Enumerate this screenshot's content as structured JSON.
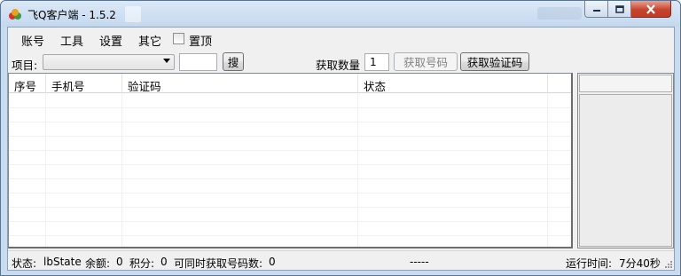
{
  "window": {
    "title": "飞Q客户端 - 1.5.2"
  },
  "menu": {
    "account": "账号",
    "tools": "工具",
    "settings": "设置",
    "other": "其它",
    "pin_top": "置顶",
    "pin_top_checked": false
  },
  "toolbar": {
    "project_label": "项目:",
    "project_value": "",
    "search_value": "",
    "search_button": "搜",
    "quantity_label": "获取数量",
    "quantity_value": "1",
    "get_number_button": "获取号码",
    "get_code_button": "获取验证码"
  },
  "table": {
    "columns": [
      "序号",
      "手机号",
      "验证码",
      "状态"
    ],
    "rows": []
  },
  "status": {
    "state_label": "状态:",
    "state_value": "lbState",
    "balance_label": "余额:",
    "balance_value": "0",
    "points_label": "积分:",
    "points_value": "0",
    "concurrent_label": "可同时获取号码数:",
    "concurrent_value": "0",
    "middle": "-----",
    "runtime_label": "运行时间:",
    "runtime_value": "7分40秒"
  },
  "colors": {
    "titlebar": "#c4d8ee",
    "close_button": "#c7452f"
  }
}
